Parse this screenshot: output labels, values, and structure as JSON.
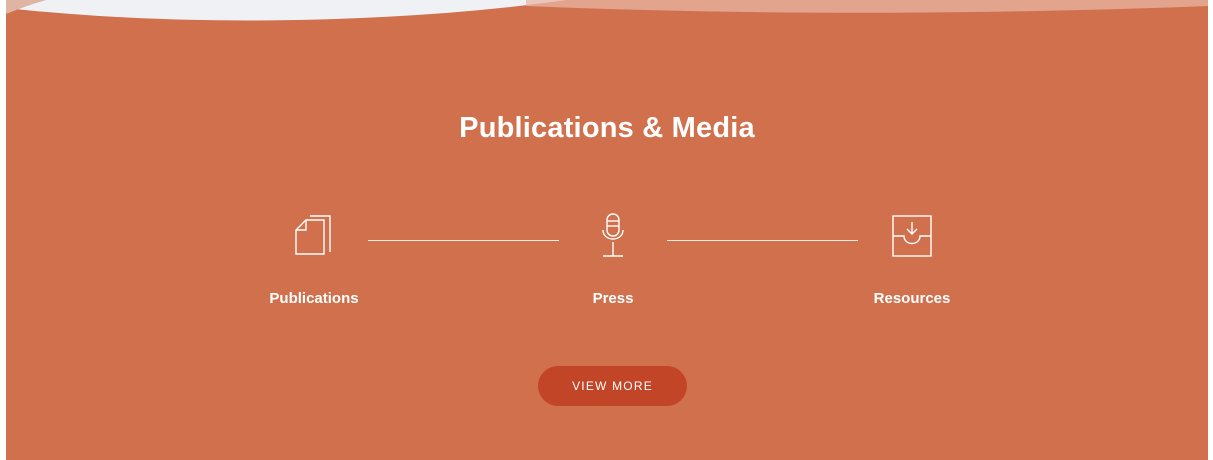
{
  "section": {
    "title": "Publications & Media",
    "background_color": "#d0704c"
  },
  "items": [
    {
      "label": "Publications",
      "icon": "documents-icon"
    },
    {
      "label": "Press",
      "icon": "microphone-icon"
    },
    {
      "label": "Resources",
      "icon": "inbox-download-icon"
    }
  ],
  "cta": {
    "label": "VIEW MORE",
    "color": "#c24528"
  }
}
